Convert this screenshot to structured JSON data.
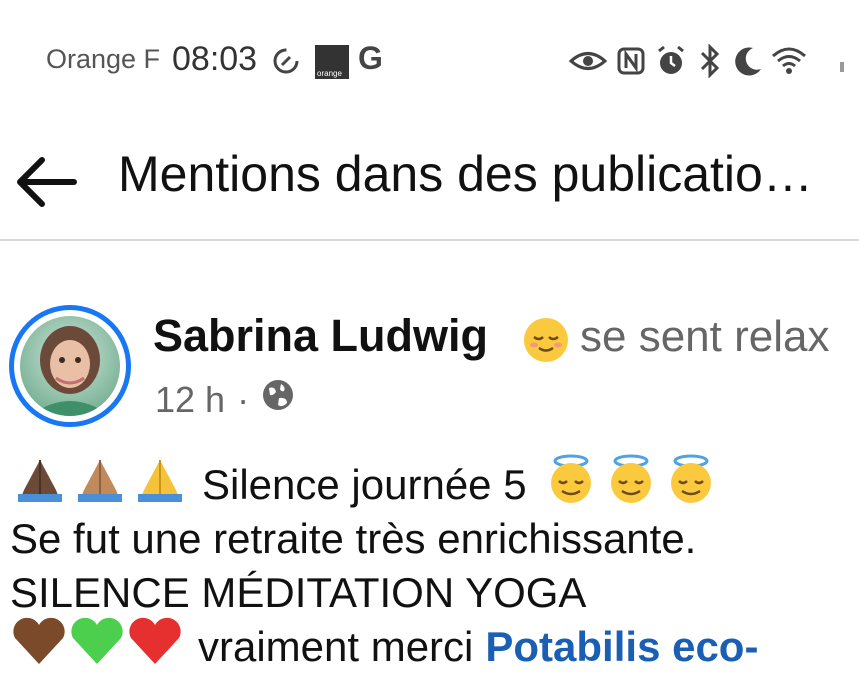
{
  "status_bar": {
    "carrier": "Orange F",
    "time": "08:03",
    "operator_badge_text": "orange",
    "network_letter": "G"
  },
  "header": {
    "title": "Mentions dans des publicatio…"
  },
  "post": {
    "author": "Sabrina Ludwig",
    "feeling": "se sent relax",
    "time_ago": "12 h",
    "separator": "·",
    "lines": {
      "line1": "Silence journée 5",
      "line2": "Se fut une retraite très enrichissante.",
      "line3": "SILENCE MÉDITATION YOGA",
      "line4_text": "vraiment merci",
      "line4_mention": "Potabilis eco-"
    }
  },
  "colors": {
    "accent": "#1877f2",
    "link": "#1a5fb4"
  }
}
